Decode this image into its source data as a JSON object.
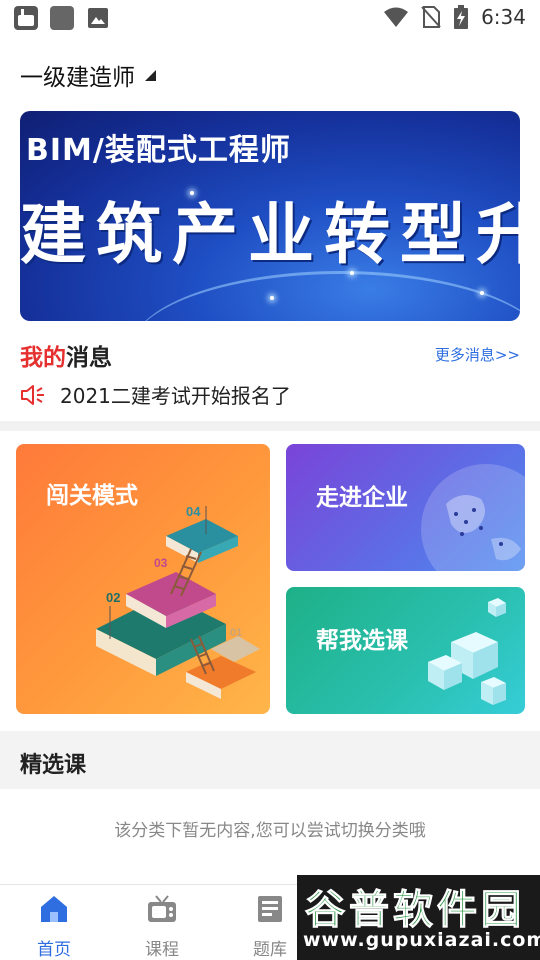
{
  "statusbar": {
    "time": "6:34",
    "left_icons": [
      "app-notification-icon",
      "square-notification-icon",
      "image-notification-icon"
    ],
    "right_icons": [
      "wifi-icon",
      "no-sim-icon",
      "battery-charging-icon"
    ]
  },
  "header": {
    "title": "一级建造师"
  },
  "banner": {
    "line1": "BIM/装配式工程师",
    "line2": "建筑产业转型升级"
  },
  "messages": {
    "title_prefix": "我的",
    "title_suffix": "消息",
    "more_link": "更多消息>>",
    "notice": "2021二建考试开始报名了"
  },
  "cards": {
    "challenge": "闯关模式",
    "enterprise": "走进企业",
    "help_course": "帮我选课"
  },
  "section": {
    "title": "精选课",
    "empty": "该分类下暂无内容,您可以尝试切换分类哦"
  },
  "tabs": [
    {
      "label": "首页",
      "icon": "home-icon",
      "active": true
    },
    {
      "label": "课程",
      "icon": "tv-icon",
      "active": false
    },
    {
      "label": "题库",
      "icon": "question-bank-icon",
      "active": false
    }
  ],
  "watermark": {
    "top": "谷普软件园",
    "bottom": "www.gupuxiazai.com"
  },
  "colors": {
    "accent": "#2e6ee0",
    "red": "#e62f2f",
    "challenge_card": "#ff8c3a",
    "enterprise_card": "#6a5ae0",
    "course_card": "#27bba0"
  }
}
